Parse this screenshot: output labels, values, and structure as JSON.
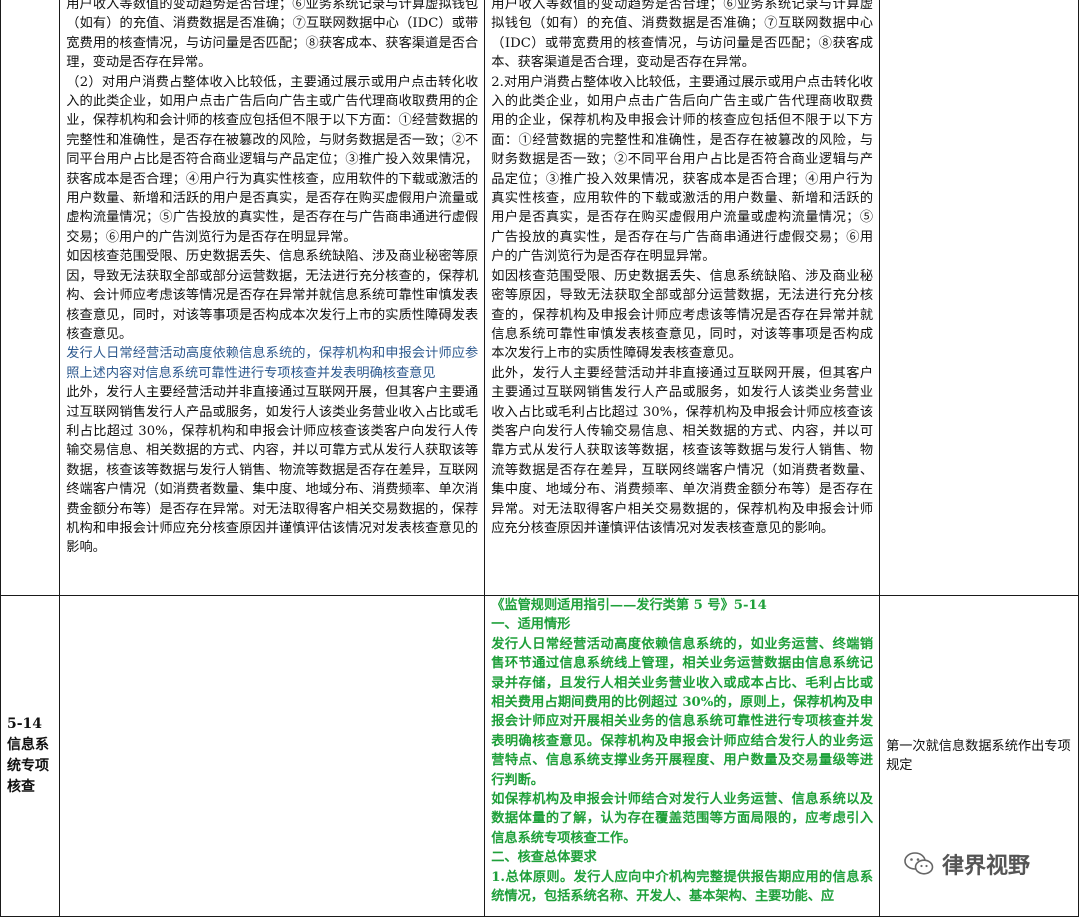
{
  "row1": {
    "col2": [
      {
        "text": "用户收入等数值的变动趋势是否合理；⑥业务系统记录与计算虚拟钱包（如有）的充值、消费数据是否准确；⑦互联网数据中心（IDC）或带宽费用的核查情况，与访问量是否匹配；⑧获客成本、获客渠道是否合理，变动是否存在异常。",
        "style": "normal"
      },
      {
        "text": "（2）对用户消费占整体收入比较低，主要通过展示或用户点击转化收入的此类企业，如用户点击广告后向广告主或广告代理商收取费用的企业，保荐机构和会计师的核查应包括但不限于以下方面：①经营数据的完整性和准确性，是否存在被篡改的风险，与财务数据是否一致；②不同平台用户占比是否符合商业逻辑与产品定位；③推广投入效果情况，获客成本是否合理；④用户行为真实性核查，应用软件的下载或激活的用户数量、新增和活跃的用户是否真实，是否存在购买虚假用户流量或虚构流量情况；⑤广告投放的真实性，是否存在与广告商串通进行虚假交易；⑥用户的广告浏览行为是否存在明显异常。",
        "style": "normal"
      },
      {
        "text": "如因核查范围受限、历史数据丢失、信息系统缺陷、涉及商业秘密等原因，导致无法获取全部或部分运营数据，无法进行充分核查的，保荐机构、会计师应考虑该等情况是否存在异常并就信息系统可靠性审慎发表核查意见，同时，对该等事项是否构成本次发行上市的实质性障碍发表核查意见。",
        "style": "normal"
      },
      {
        "text": "发行人日常经营活动高度依赖信息系统的，保荐机构和申报会计师应参照上述内容对信息系统可靠性进行专项核查并发表明确核查意见",
        "style": "blue"
      },
      {
        "text": "此外，发行人主要经营活动并非直接通过互联网开展，但其客户主要通过互联网销售发行人产品或服务，如发行人该类业务营业收入占比或毛利占比超过 30%，保荐机构和申报会计师应核查该类客户向发行人传输交易信息、相关数据的方式、内容，并以可靠方式从发行人获取该等数据，核查该等数据与发行人销售、物流等数据是否存在差异，互联网终端客户情况（如消费者数量、集中度、地域分布、消费频率、单次消费金额分布等）是否存在异常。对无法取得客户相关交易数据的，保荐机构和申报会计师应充分核查原因并谨慎评估该情况对发表核查意见的影响。",
        "style": "normal"
      }
    ],
    "col3": [
      {
        "text": "用户收入等数值的变动趋势是否合理；⑥业务系统记录与计算虚拟钱包（如有）的充值、消费数据是否准确；⑦互联网数据中心（IDC）或带宽费用的核查情况，与访问量是否匹配；⑧获客成本、获客渠道是否合理，变动是否存在异常。",
        "style": "normal"
      },
      {
        "text": "2.对用户消费占整体收入比较低，主要通过展示或用户点击转化收入的此类企业，如用户点击广告后向广告主或广告代理商收取费用的企业，保荐机构及申报会计师的核查应包括但不限于以下方面：①经营数据的完整性和准确性，是否存在被篡改的风险，与财务数据是否一致；②不同平台用户占比是否符合商业逻辑与产品定位；③推广投入效果情况，获客成本是否合理；④用户行为真实性核查，应用软件的下载或激活的用户数量、新增和活跃的用户是否真实，是否存在购买虚假用户流量或虚构流量情况；⑤广告投放的真实性，是否存在与广告商串通进行虚假交易；⑥用户的广告浏览行为是否存在明显异常。",
        "style": "normal"
      },
      {
        "text": "如因核查范围受限、历史数据丢失、信息系统缺陷、涉及商业秘密等原因，导致无法获取全部或部分运营数据，无法进行充分核查的，保荐机构及申报会计师应考虑该等情况是否存在异常并就信息系统可靠性审慎发表核查意见，同时，对该等事项是否构成本次发行上市的实质性障碍发表核查意见。",
        "style": "normal"
      },
      {
        "text": "此外，发行人主要经营活动并非直接通过互联网开展，但其客户主要通过互联网销售发行人产品或服务，如发行人该类业务营业收入占比或毛利占比超过 30%，保荐机构及申报会计师应核查该类客户向发行人传输交易信息、相关数据的方式、内容，并以可靠方式从发行人获取该等数据，核查该等数据与发行人销售、物流等数据是否存在差异，互联网终端客户情况（如消费者数量、集中度、地域分布、消费频率、单次消费金额分布等）是否存在异常。对无法取得客户相关交易数据的，保荐机构及申报会计师应充分核查原因并谨慎评估该情况对发表核查意见的影响。",
        "style": "normal"
      }
    ]
  },
  "row2": {
    "label": "5-14信息系统专项核查",
    "col3": [
      {
        "text": "《监管规则适用指引——发行类第 5 号》5-14",
        "style": "green"
      },
      {
        "text": "一、适用情形",
        "style": "green"
      },
      {
        "text": "发行人日常经营活动高度依赖信息系统的，如业务运营、终端销售环节通过信息系统线上管理，相关业务运营数据由信息系统记录并存储，且发行人相关业务营业收入或成本占比、毛利占比或相关费用占期间费用的比例超过 30%的，原则上，保荐机构及申报会计师应对开展相关业务的信息系统可靠性进行专项核查并发表明确核查意见。保荐机构及申报会计师应结合发行人的业务运营特点、信息系统支撑业务开展程度、用户数量及交易量级等进行判断。",
        "style": "green"
      },
      {
        "text": "如保荐机构及申报会计师结合对发行人业务运营、信息系统以及数据体量的了解，认为存在覆盖范围等方面局限的，应考虑引入信息系统专项核查工作。",
        "style": "green"
      },
      {
        "text": "二、核查总体要求",
        "style": "green"
      },
      {
        "text": "1.总体原则。发行人应向中介机构完整提供报告期应用的信息系统情况，包括系统名称、开发人、基本架构、主要功能、应",
        "style": "green"
      }
    ],
    "note": "第一次就信息数据系统作出专项规定"
  },
  "watermark": {
    "text": "律界视野",
    "icon": "wechat-icon"
  }
}
